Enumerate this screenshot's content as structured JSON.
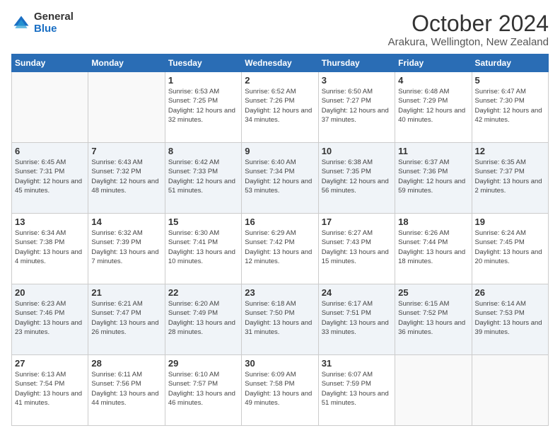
{
  "header": {
    "logo_general": "General",
    "logo_blue": "Blue",
    "month": "October 2024",
    "location": "Arakura, Wellington, New Zealand"
  },
  "days_of_week": [
    "Sunday",
    "Monday",
    "Tuesday",
    "Wednesday",
    "Thursday",
    "Friday",
    "Saturday"
  ],
  "weeks": [
    [
      {
        "day": "",
        "sunrise": "",
        "sunset": "",
        "daylight": ""
      },
      {
        "day": "",
        "sunrise": "",
        "sunset": "",
        "daylight": ""
      },
      {
        "day": "1",
        "sunrise": "Sunrise: 6:53 AM",
        "sunset": "Sunset: 7:25 PM",
        "daylight": "Daylight: 12 hours and 32 minutes."
      },
      {
        "day": "2",
        "sunrise": "Sunrise: 6:52 AM",
        "sunset": "Sunset: 7:26 PM",
        "daylight": "Daylight: 12 hours and 34 minutes."
      },
      {
        "day": "3",
        "sunrise": "Sunrise: 6:50 AM",
        "sunset": "Sunset: 7:27 PM",
        "daylight": "Daylight: 12 hours and 37 minutes."
      },
      {
        "day": "4",
        "sunrise": "Sunrise: 6:48 AM",
        "sunset": "Sunset: 7:29 PM",
        "daylight": "Daylight: 12 hours and 40 minutes."
      },
      {
        "day": "5",
        "sunrise": "Sunrise: 6:47 AM",
        "sunset": "Sunset: 7:30 PM",
        "daylight": "Daylight: 12 hours and 42 minutes."
      }
    ],
    [
      {
        "day": "6",
        "sunrise": "Sunrise: 6:45 AM",
        "sunset": "Sunset: 7:31 PM",
        "daylight": "Daylight: 12 hours and 45 minutes."
      },
      {
        "day": "7",
        "sunrise": "Sunrise: 6:43 AM",
        "sunset": "Sunset: 7:32 PM",
        "daylight": "Daylight: 12 hours and 48 minutes."
      },
      {
        "day": "8",
        "sunrise": "Sunrise: 6:42 AM",
        "sunset": "Sunset: 7:33 PM",
        "daylight": "Daylight: 12 hours and 51 minutes."
      },
      {
        "day": "9",
        "sunrise": "Sunrise: 6:40 AM",
        "sunset": "Sunset: 7:34 PM",
        "daylight": "Daylight: 12 hours and 53 minutes."
      },
      {
        "day": "10",
        "sunrise": "Sunrise: 6:38 AM",
        "sunset": "Sunset: 7:35 PM",
        "daylight": "Daylight: 12 hours and 56 minutes."
      },
      {
        "day": "11",
        "sunrise": "Sunrise: 6:37 AM",
        "sunset": "Sunset: 7:36 PM",
        "daylight": "Daylight: 12 hours and 59 minutes."
      },
      {
        "day": "12",
        "sunrise": "Sunrise: 6:35 AM",
        "sunset": "Sunset: 7:37 PM",
        "daylight": "Daylight: 13 hours and 2 minutes."
      }
    ],
    [
      {
        "day": "13",
        "sunrise": "Sunrise: 6:34 AM",
        "sunset": "Sunset: 7:38 PM",
        "daylight": "Daylight: 13 hours and 4 minutes."
      },
      {
        "day": "14",
        "sunrise": "Sunrise: 6:32 AM",
        "sunset": "Sunset: 7:39 PM",
        "daylight": "Daylight: 13 hours and 7 minutes."
      },
      {
        "day": "15",
        "sunrise": "Sunrise: 6:30 AM",
        "sunset": "Sunset: 7:41 PM",
        "daylight": "Daylight: 13 hours and 10 minutes."
      },
      {
        "day": "16",
        "sunrise": "Sunrise: 6:29 AM",
        "sunset": "Sunset: 7:42 PM",
        "daylight": "Daylight: 13 hours and 12 minutes."
      },
      {
        "day": "17",
        "sunrise": "Sunrise: 6:27 AM",
        "sunset": "Sunset: 7:43 PM",
        "daylight": "Daylight: 13 hours and 15 minutes."
      },
      {
        "day": "18",
        "sunrise": "Sunrise: 6:26 AM",
        "sunset": "Sunset: 7:44 PM",
        "daylight": "Daylight: 13 hours and 18 minutes."
      },
      {
        "day": "19",
        "sunrise": "Sunrise: 6:24 AM",
        "sunset": "Sunset: 7:45 PM",
        "daylight": "Daylight: 13 hours and 20 minutes."
      }
    ],
    [
      {
        "day": "20",
        "sunrise": "Sunrise: 6:23 AM",
        "sunset": "Sunset: 7:46 PM",
        "daylight": "Daylight: 13 hours and 23 minutes."
      },
      {
        "day": "21",
        "sunrise": "Sunrise: 6:21 AM",
        "sunset": "Sunset: 7:47 PM",
        "daylight": "Daylight: 13 hours and 26 minutes."
      },
      {
        "day": "22",
        "sunrise": "Sunrise: 6:20 AM",
        "sunset": "Sunset: 7:49 PM",
        "daylight": "Daylight: 13 hours and 28 minutes."
      },
      {
        "day": "23",
        "sunrise": "Sunrise: 6:18 AM",
        "sunset": "Sunset: 7:50 PM",
        "daylight": "Daylight: 13 hours and 31 minutes."
      },
      {
        "day": "24",
        "sunrise": "Sunrise: 6:17 AM",
        "sunset": "Sunset: 7:51 PM",
        "daylight": "Daylight: 13 hours and 33 minutes."
      },
      {
        "day": "25",
        "sunrise": "Sunrise: 6:15 AM",
        "sunset": "Sunset: 7:52 PM",
        "daylight": "Daylight: 13 hours and 36 minutes."
      },
      {
        "day": "26",
        "sunrise": "Sunrise: 6:14 AM",
        "sunset": "Sunset: 7:53 PM",
        "daylight": "Daylight: 13 hours and 39 minutes."
      }
    ],
    [
      {
        "day": "27",
        "sunrise": "Sunrise: 6:13 AM",
        "sunset": "Sunset: 7:54 PM",
        "daylight": "Daylight: 13 hours and 41 minutes."
      },
      {
        "day": "28",
        "sunrise": "Sunrise: 6:11 AM",
        "sunset": "Sunset: 7:56 PM",
        "daylight": "Daylight: 13 hours and 44 minutes."
      },
      {
        "day": "29",
        "sunrise": "Sunrise: 6:10 AM",
        "sunset": "Sunset: 7:57 PM",
        "daylight": "Daylight: 13 hours and 46 minutes."
      },
      {
        "day": "30",
        "sunrise": "Sunrise: 6:09 AM",
        "sunset": "Sunset: 7:58 PM",
        "daylight": "Daylight: 13 hours and 49 minutes."
      },
      {
        "day": "31",
        "sunrise": "Sunrise: 6:07 AM",
        "sunset": "Sunset: 7:59 PM",
        "daylight": "Daylight: 13 hours and 51 minutes."
      },
      {
        "day": "",
        "sunrise": "",
        "sunset": "",
        "daylight": ""
      },
      {
        "day": "",
        "sunrise": "",
        "sunset": "",
        "daylight": ""
      }
    ]
  ]
}
